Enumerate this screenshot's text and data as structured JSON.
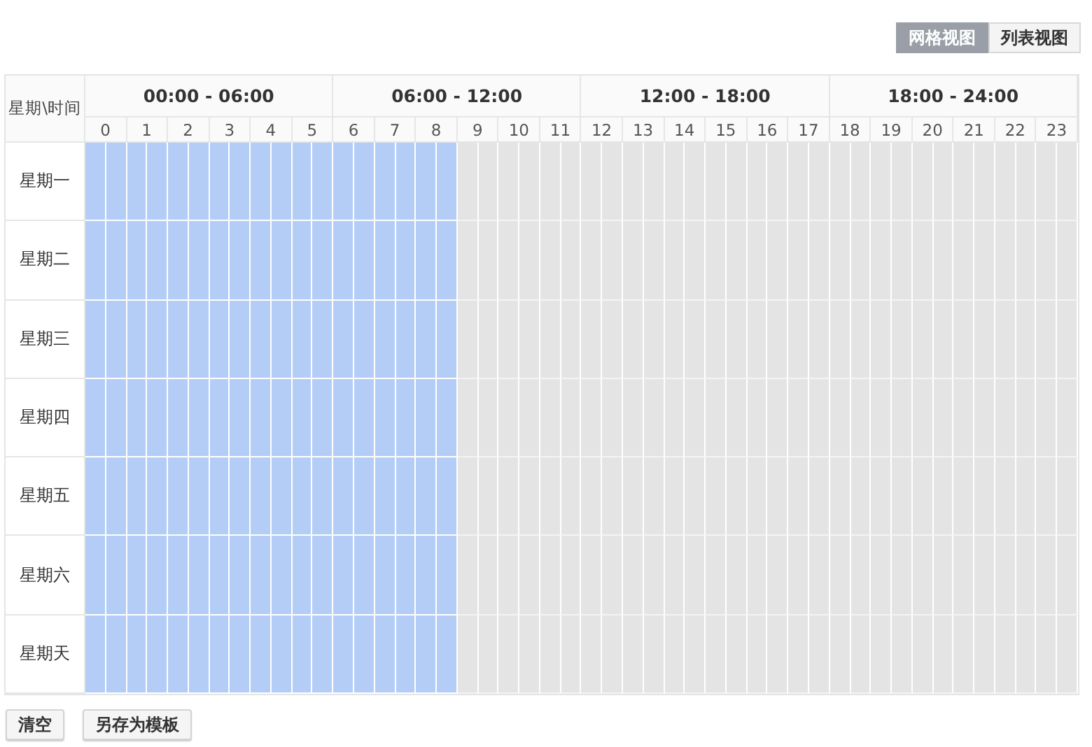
{
  "view_toggle": [
    {
      "label": "网格视图",
      "selected": true
    },
    {
      "label": "列表视图",
      "selected": false
    }
  ],
  "corner_label": "星期\\时间",
  "periods": [
    "00:00 - 06:00",
    "06:00 - 12:00",
    "12:00 - 18:00",
    "18:00 - 24:00"
  ],
  "hours": [
    "0",
    "1",
    "2",
    "3",
    "4",
    "5",
    "6",
    "7",
    "8",
    "9",
    "10",
    "11",
    "12",
    "13",
    "14",
    "15",
    "16",
    "17",
    "18",
    "19",
    "20",
    "21",
    "22",
    "23"
  ],
  "days": [
    {
      "label": "星期一",
      "slots": [
        true,
        true,
        true,
        true,
        true,
        true,
        true,
        true,
        true,
        true,
        true,
        true,
        true,
        true,
        true,
        true,
        true,
        true,
        false,
        false,
        false,
        false,
        false,
        false,
        false,
        false,
        false,
        false,
        false,
        false,
        false,
        false,
        false,
        false,
        false,
        false,
        false,
        false,
        false,
        false,
        false,
        false,
        false,
        false,
        false,
        false,
        false,
        false
      ]
    },
    {
      "label": "星期二",
      "slots": [
        true,
        true,
        true,
        true,
        true,
        true,
        true,
        true,
        true,
        true,
        true,
        true,
        true,
        true,
        true,
        true,
        true,
        true,
        false,
        false,
        false,
        false,
        false,
        false,
        false,
        false,
        false,
        false,
        false,
        false,
        false,
        false,
        false,
        false,
        false,
        false,
        false,
        false,
        false,
        false,
        false,
        false,
        false,
        false,
        false,
        false,
        false,
        false
      ]
    },
    {
      "label": "星期三",
      "slots": [
        true,
        true,
        true,
        true,
        true,
        true,
        true,
        true,
        true,
        true,
        true,
        true,
        true,
        true,
        true,
        true,
        true,
        true,
        false,
        false,
        false,
        false,
        false,
        false,
        false,
        false,
        false,
        false,
        false,
        false,
        false,
        false,
        false,
        false,
        false,
        false,
        false,
        false,
        false,
        false,
        false,
        false,
        false,
        false,
        false,
        false,
        false,
        false
      ]
    },
    {
      "label": "星期四",
      "slots": [
        true,
        true,
        true,
        true,
        true,
        true,
        true,
        true,
        true,
        true,
        true,
        true,
        true,
        true,
        true,
        true,
        true,
        true,
        false,
        false,
        false,
        false,
        false,
        false,
        false,
        false,
        false,
        false,
        false,
        false,
        false,
        false,
        false,
        false,
        false,
        false,
        false,
        false,
        false,
        false,
        false,
        false,
        false,
        false,
        false,
        false,
        false,
        false
      ]
    },
    {
      "label": "星期五",
      "slots": [
        true,
        true,
        true,
        true,
        true,
        true,
        true,
        true,
        true,
        true,
        true,
        true,
        true,
        true,
        true,
        true,
        true,
        true,
        false,
        false,
        false,
        false,
        false,
        false,
        false,
        false,
        false,
        false,
        false,
        false,
        false,
        false,
        false,
        false,
        false,
        false,
        false,
        false,
        false,
        false,
        false,
        false,
        false,
        false,
        false,
        false,
        false,
        false
      ]
    },
    {
      "label": "星期六",
      "slots": [
        true,
        true,
        true,
        true,
        true,
        true,
        true,
        true,
        true,
        true,
        true,
        true,
        true,
        true,
        true,
        true,
        true,
        true,
        false,
        false,
        false,
        false,
        false,
        false,
        false,
        false,
        false,
        false,
        false,
        false,
        false,
        false,
        false,
        false,
        false,
        false,
        false,
        false,
        false,
        false,
        false,
        false,
        false,
        false,
        false,
        false,
        false,
        false
      ]
    },
    {
      "label": "星期天",
      "slots": [
        true,
        true,
        true,
        true,
        true,
        true,
        true,
        true,
        true,
        true,
        true,
        true,
        true,
        true,
        true,
        true,
        true,
        true,
        false,
        false,
        false,
        false,
        false,
        false,
        false,
        false,
        false,
        false,
        false,
        false,
        false,
        false,
        false,
        false,
        false,
        false,
        false,
        false,
        false,
        false,
        false,
        false,
        false,
        false,
        false,
        false,
        false,
        false
      ]
    }
  ],
  "actions": [
    "清空",
    "另存为模板"
  ]
}
